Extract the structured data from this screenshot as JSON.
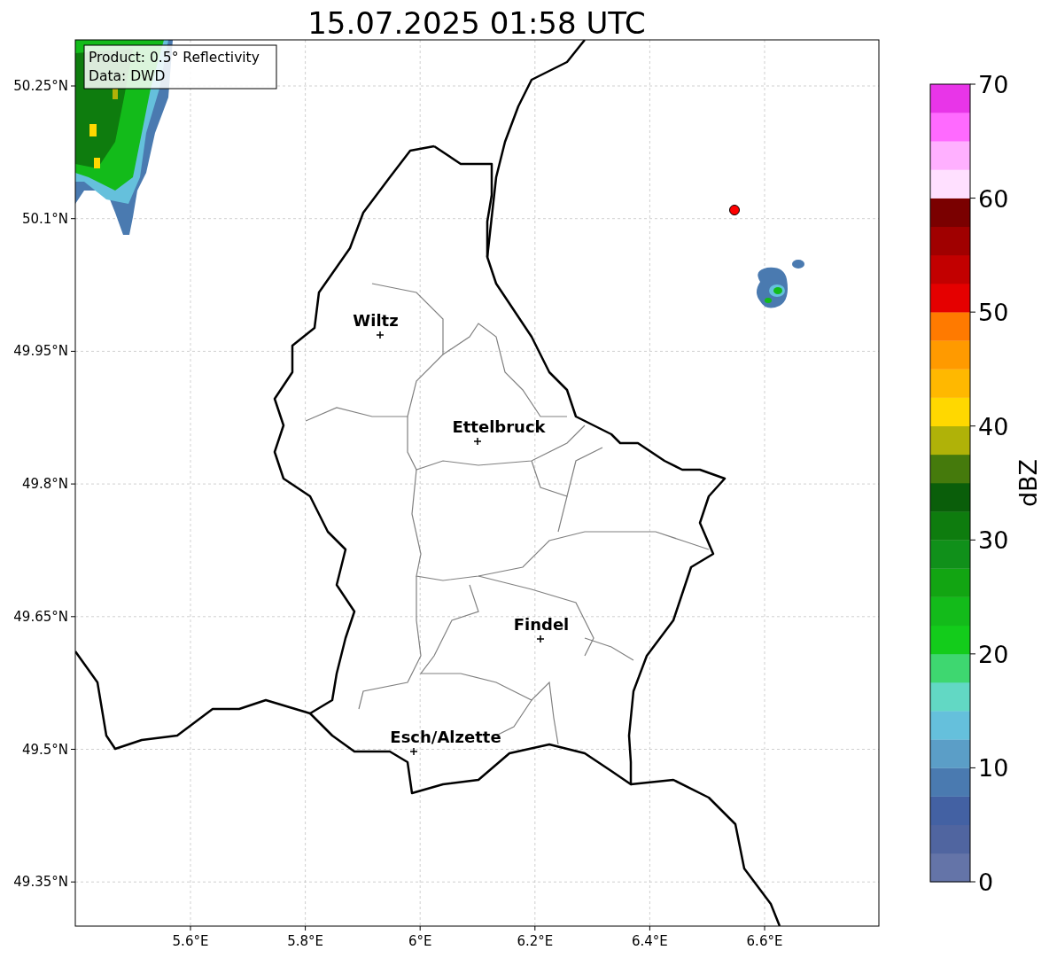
{
  "title": "15.07.2025 01:58 UTC",
  "info_box": [
    "Product: 0.5° Reflectivity",
    "Data: DWD"
  ],
  "x_ticks": [
    "5.6°E",
    "5.8°E",
    "6°E",
    "6.2°E",
    "6.4°E",
    "6.6°E"
  ],
  "y_ticks": [
    "50.25°N",
    "50.1°N",
    "49.95°N",
    "49.8°N",
    "49.65°N",
    "49.5°N",
    "49.35°N"
  ],
  "cities": [
    {
      "name": "Wiltz"
    },
    {
      "name": "Ettelbruck"
    },
    {
      "name": "Findel"
    },
    {
      "name": "Esch/Alzette"
    }
  ],
  "colorbar": {
    "label": "dBZ",
    "ticks": [
      "70",
      "60",
      "50",
      "40",
      "30",
      "20",
      "10",
      "0"
    ],
    "bins": [
      {
        "color": "#6474a8"
      },
      {
        "color": "#5065a0"
      },
      {
        "color": "#4361a3"
      },
      {
        "color": "#4a7ab0"
      },
      {
        "color": "#5b9ec7"
      },
      {
        "color": "#65c0dc"
      },
      {
        "color": "#62d8c4"
      },
      {
        "color": "#3ed770"
      },
      {
        "color": "#13cc1b"
      },
      {
        "color": "#13bb1a"
      },
      {
        "color": "#12a512"
      },
      {
        "color": "#10901a"
      },
      {
        "color": "#0e7c0e"
      },
      {
        "color": "#0a5e0a"
      },
      {
        "color": "#457a0c"
      },
      {
        "color": "#b0b208"
      },
      {
        "color": "#ffd800"
      },
      {
        "color": "#ffb800"
      },
      {
        "color": "#ff9a00"
      },
      {
        "color": "#ff7a00"
      },
      {
        "color": "#e50000"
      },
      {
        "color": "#c20000"
      },
      {
        "color": "#a00000"
      },
      {
        "color": "#7a0000"
      },
      {
        "color": "#ffe0ff"
      },
      {
        "color": "#ffb0ff"
      },
      {
        "color": "#ff6aff"
      },
      {
        "color": "#e835e8"
      }
    ]
  }
}
